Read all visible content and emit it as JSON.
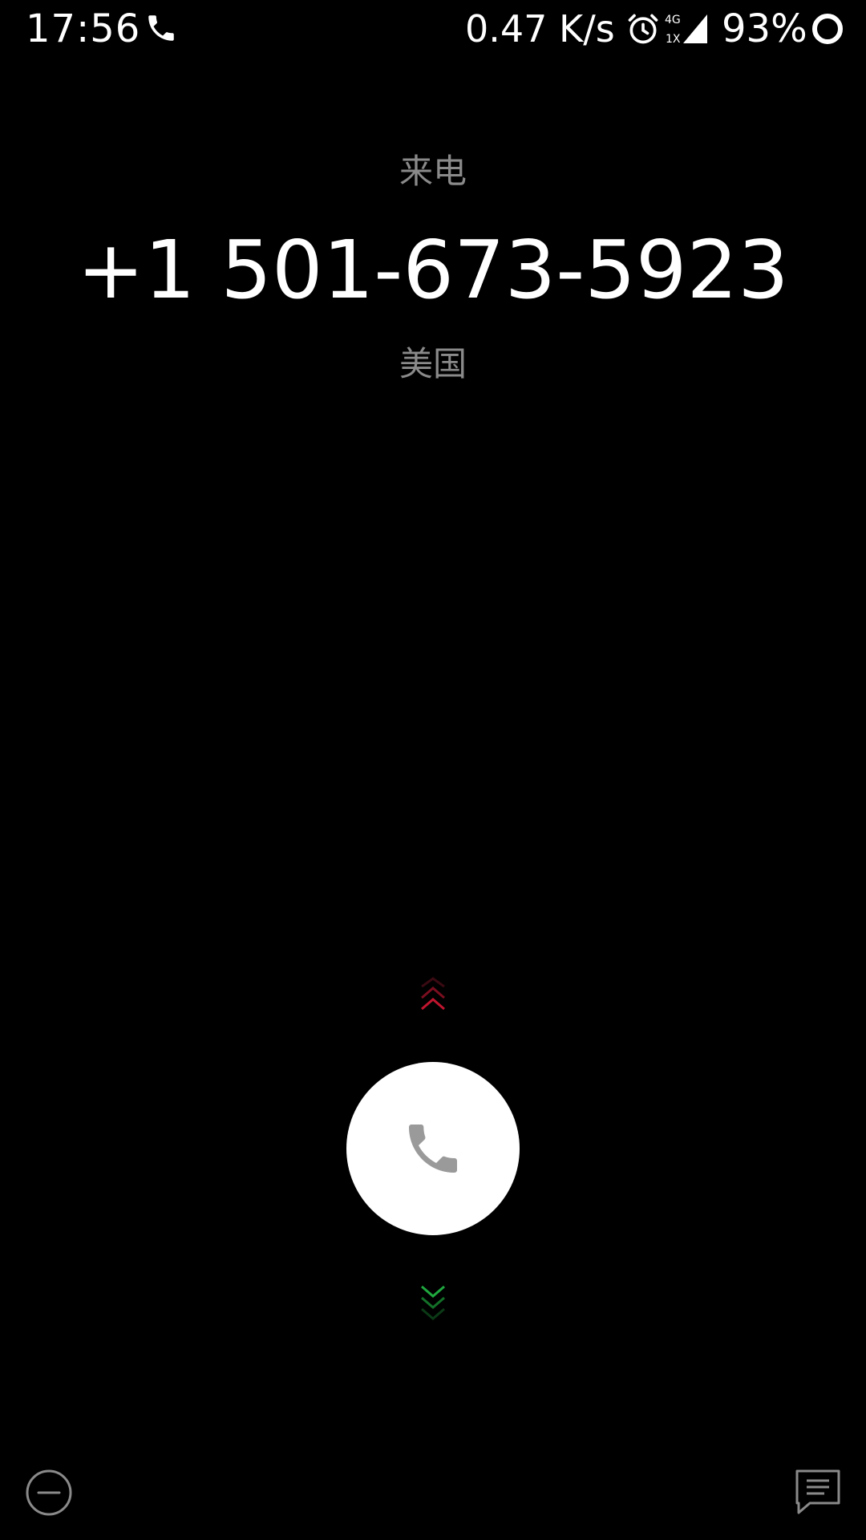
{
  "status_bar": {
    "time": "17:56",
    "net_speed": "0.47 K/s",
    "net_type_top": "4G",
    "net_type_bottom": "1X",
    "battery_percent": "93%",
    "icons": [
      "call-icon",
      "alarm-icon",
      "signal-icon",
      "battery-icon"
    ]
  },
  "call": {
    "status_label": "来电",
    "number": "+1 501-673-5923",
    "location": "美国"
  },
  "controls": {
    "answer_icon": "phone-icon",
    "swipe_up_icon": "double-chevron-up-icon",
    "swipe_down_icon": "double-chevron-down-icon",
    "decline_icon": "minus-circle-icon",
    "sms_icon": "message-icon"
  },
  "colors": {
    "background": "#000000",
    "secondary_text": "#8a8a8a",
    "swipe_up_accent": "#c0152f",
    "swipe_down_accent": "#1fa83f",
    "answer_button_bg": "#ffffff",
    "answer_icon": "#9a9a9a"
  }
}
